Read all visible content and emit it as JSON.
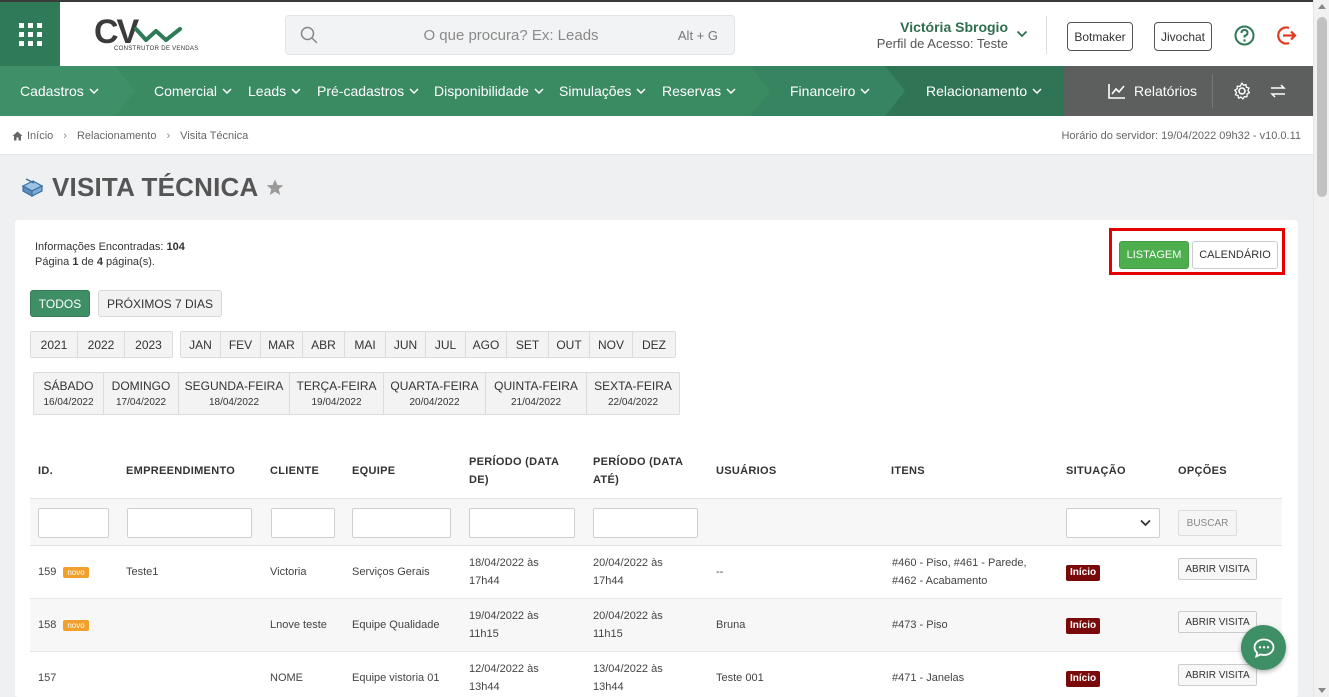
{
  "header": {
    "logo_text": "CV",
    "logo_sub": "CONSTRUTOR DE VENDAS",
    "search_placeholder": "O que procura? Ex: Leads",
    "search_shortcut": "Alt + G",
    "user_name": "Victória Sbrogio",
    "user_profile": "Perfil de Acesso: Teste",
    "botmaker": "Botmaker",
    "jivochat": "Jivochat"
  },
  "nav": {
    "items": [
      "Cadastros",
      "Comercial",
      "Leads",
      "Pré-cadastros",
      "Disponibilidade",
      "Simulações",
      "Reservas",
      "Financeiro",
      "Relacionamento"
    ],
    "relatorios": "Relatórios"
  },
  "breadcrumb": {
    "home": "Início",
    "section": "Relacionamento",
    "page": "Visita Técnica",
    "server_time": "Horário do servidor: 19/04/2022 09h32 - v10.0.11"
  },
  "page": {
    "title": "VISITA TÉCNICA",
    "info_label": "Informações Encontradas:",
    "info_count": "104",
    "page_word": "Página",
    "page_current": "1",
    "page_of": "de",
    "page_total": "4",
    "page_suffix": "página(s).",
    "view_list": "LISTAGEM",
    "view_calendar": "CALENDÁRIO"
  },
  "filters": {
    "todos": "TODOS",
    "next7": "PRÓXIMOS 7 DIAS",
    "years": [
      "2021",
      "2022",
      "2023"
    ],
    "months": [
      "JAN",
      "FEV",
      "MAR",
      "ABR",
      "MAI",
      "JUN",
      "JUL",
      "AGO",
      "SET",
      "OUT",
      "NOV",
      "DEZ"
    ],
    "days": [
      {
        "name": "SÁBADO",
        "date": "16/04/2022"
      },
      {
        "name": "DOMINGO",
        "date": "17/04/2022"
      },
      {
        "name": "SEGUNDA-FEIRA",
        "date": "18/04/2022"
      },
      {
        "name": "TERÇA-FEIRA",
        "date": "19/04/2022"
      },
      {
        "name": "QUARTA-FEIRA",
        "date": "20/04/2022"
      },
      {
        "name": "QUINTA-FEIRA",
        "date": "21/04/2022"
      },
      {
        "name": "SEXTA-FEIRA",
        "date": "22/04/2022"
      }
    ]
  },
  "table": {
    "headers": {
      "id": "ID.",
      "empreendimento": "EMPREENDIMENTO",
      "cliente": "CLIENTE",
      "equipe": "EQUIPE",
      "periodo_de_1": "PERÍODO (DATA",
      "periodo_de_2": "DE)",
      "periodo_ate_1": "PERÍODO (DATA",
      "periodo_ate_2": "ATÉ)",
      "usuarios": "USUÁRIOS",
      "itens": "ITENS",
      "situacao": "SITUAÇÃO",
      "opcoes": "OPÇÕES"
    },
    "search_button": "BUSCAR",
    "rows": [
      {
        "id": "159",
        "novo": "novo",
        "empreendimento": "Teste1",
        "cliente": "Victoria",
        "equipe": "Serviços Gerais",
        "de_1": "18/04/2022 às",
        "de_2": "17h44",
        "ate_1": "20/04/2022 às",
        "ate_2": "17h44",
        "usuarios": "--",
        "itens_1": "#460 - Piso, #461 - Parede,",
        "itens_2": "#462 - Acabamento",
        "situacao": "Início",
        "acao": "ABRIR VISITA"
      },
      {
        "id": "158",
        "novo": "novo",
        "empreendimento": "",
        "cliente": "Lnove teste",
        "equipe": "Equipe Qualidade",
        "de_1": "19/04/2022 às",
        "de_2": "11h15",
        "ate_1": "20/04/2022 às",
        "ate_2": "11h15",
        "usuarios": "Bruna",
        "itens_1": "#473 - Piso",
        "itens_2": "",
        "situacao": "Início",
        "acao": "ABRIR VISITA"
      },
      {
        "id": "157",
        "novo": "",
        "empreendimento": "",
        "cliente": "NOME",
        "equipe": "Equipe vistoria 01",
        "de_1": "12/04/2022 às",
        "de_2": "13h44",
        "ate_1": "13/04/2022 às",
        "ate_2": "13h44",
        "usuarios": "Teste 001",
        "itens_1": "#471 - Janelas",
        "itens_2": "",
        "situacao": "Início",
        "acao": "ABRIR VISITA"
      }
    ]
  },
  "colors": {
    "brand_green": "#3f9068",
    "dark_green": "#2f7a57",
    "relatorios_gray": "#5c5f5e",
    "status_red": "#7a0a0a",
    "novo_orange": "#f0a02b",
    "highlight_red": "#e50000"
  }
}
